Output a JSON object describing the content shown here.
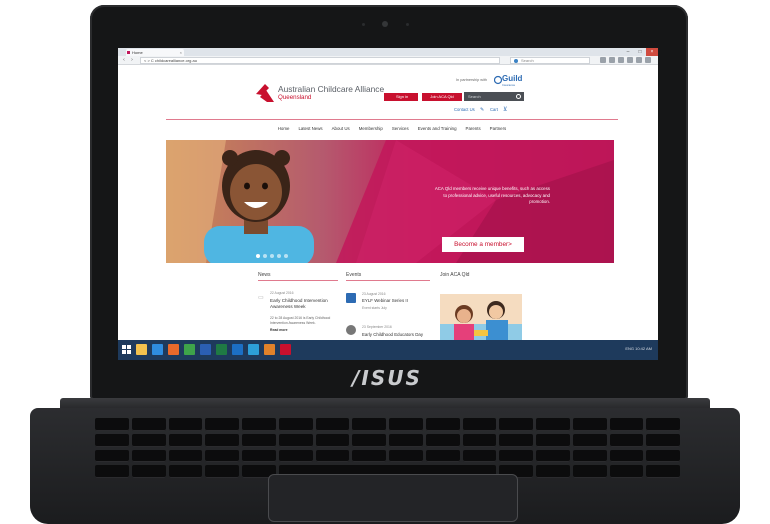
{
  "device": {
    "brand": "/ISUS"
  },
  "browser": {
    "tab_title": "Home",
    "url": "< > C   childcarealliance.org.au",
    "search_placeholder": "Search"
  },
  "site": {
    "org_name": "Australian Childcare Alliance",
    "org_state": "Queensland",
    "partner_label": "In partnership with",
    "partner_name": "Guild",
    "partner_sub": "Insurance",
    "sign_in": "Sign in",
    "join": "Join ACA Qld",
    "search_placeholder": "Search",
    "contact": "Contact Us",
    "cart": "Cart",
    "nav": [
      "Home",
      "Latest News",
      "About Us",
      "Membership",
      "Services",
      "Events and Training",
      "Parents",
      "Partners"
    ],
    "hero": {
      "text": "ACA Qld members receive unique benefits, such as access to professional advice, useful resources, advocacy and promotion.",
      "button": "Become a member>"
    },
    "news": {
      "heading": "News",
      "date": "22 August 2016",
      "title": "Early Childhood Intervention Awareness Week",
      "body": "22 to 28 August 2016 is Early Childhood Intervention Awareness Week.",
      "more": "Read more"
    },
    "events": {
      "heading": "Events",
      "day": "23",
      "date1": "23 August 2016",
      "title1": "EYLF Webinar Series II",
      "sub1": "Event starts July",
      "date2": "23 September 2016",
      "title2": "Early Childhood Educators Day"
    },
    "join_heading": "Join ACA Qld"
  },
  "colors": {
    "accent": "#c8102e",
    "hero": "#c2185b",
    "link": "#2d6bb3",
    "taskbar": "#1e3a5c"
  },
  "taskbar": {
    "icons": [
      "folder-icon",
      "ie-icon",
      "firefox-icon",
      "chrome-icon",
      "word-icon",
      "excel-icon",
      "outlook-icon",
      "photoshop-icon",
      "illustrator-icon",
      "media-icon"
    ],
    "tray": "ENG  10:42 AM"
  }
}
